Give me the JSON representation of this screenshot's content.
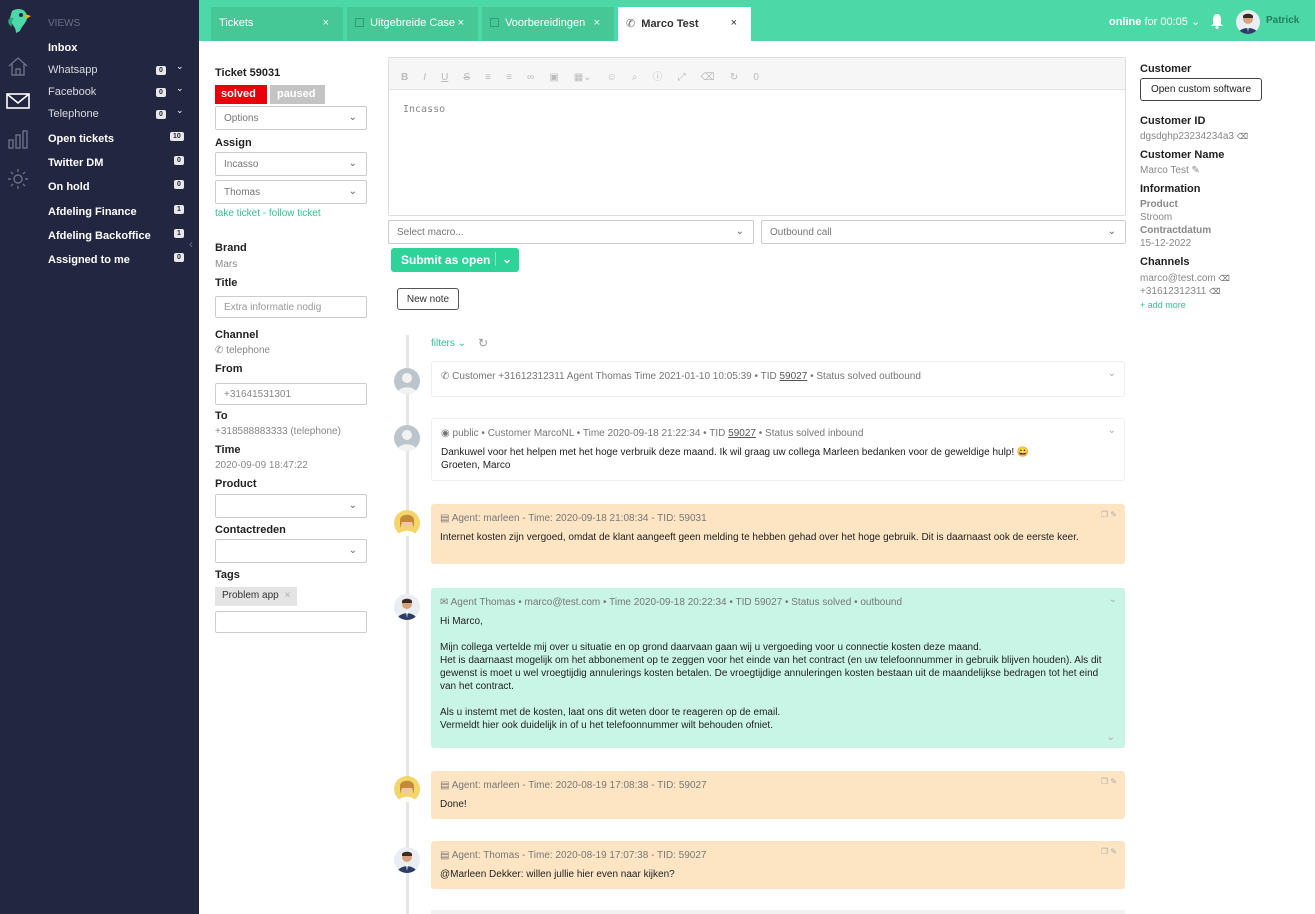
{
  "views": {
    "title": "VIEWS",
    "items": [
      {
        "label": "Inbox",
        "badge": "",
        "bold": true
      },
      {
        "label": "Whatsapp",
        "badge": "0",
        "sub": true
      },
      {
        "label": "Facebook",
        "badge": "0",
        "sub": true
      },
      {
        "label": "Telephone",
        "badge": "0",
        "sub": true
      },
      {
        "label": "Open tickets",
        "badge": "10"
      },
      {
        "label": "Twitter DM",
        "badge": "0"
      },
      {
        "label": "On hold",
        "badge": "0"
      },
      {
        "label": "Afdeling Finance",
        "badge": "1"
      },
      {
        "label": "Afdeling Backoffice",
        "badge": "1"
      },
      {
        "label": "Assigned to me",
        "badge": "0"
      }
    ]
  },
  "tabs": [
    {
      "label": "Tickets"
    },
    {
      "label": "Uitgebreide Case"
    },
    {
      "label": "Voorbereidingen"
    },
    {
      "label": "Marco Test"
    }
  ],
  "topbar": {
    "status": "online",
    "status_suffix": "for 00:05",
    "user": "Patrick"
  },
  "ticket": {
    "title": "Ticket 59031",
    "status_solved": "solved",
    "status_paused": "paused",
    "options": "Options",
    "assign_label": "Assign",
    "assign_group": "Incasso",
    "assign_agent": "Thomas",
    "take_follow": "take ticket - follow ticket",
    "brand_label": "Brand",
    "brand": "Mars",
    "title_label": "Title",
    "title_placeholder": "Extra informatie nodig",
    "channel_label": "Channel",
    "channel": "telephone",
    "from_label": "From",
    "from": "+31641531301",
    "to_label": "To",
    "to": "+318588883333 (telephone)",
    "time_label": "Time",
    "time": "2020-09-09 18:47:22",
    "product_label": "Product",
    "contactreden_label": "Contactreden",
    "tags_label": "Tags",
    "tag": "Problem app"
  },
  "editor": {
    "content": "Incasso",
    "counter": "0",
    "macro_placeholder": "Select macro...",
    "outbound": "Outbound call",
    "submit": "Submit as open",
    "new_note": "New note",
    "filters": "filters"
  },
  "timeline": [
    {
      "type": "call",
      "meta": "Customer +31612312311 Agent Thomas Time 2021-01-10 10:05:39 • TID",
      "tid": "59027",
      "meta_after": "• Status solved outbound",
      "body": []
    },
    {
      "type": "public",
      "meta": "public • Customer MarcoNL • Time 2020-09-18 21:22:34 • TID",
      "tid": "59027",
      "meta_after": "• Status solved inbound",
      "body": [
        "Dankuwel voor het helpen met het hoge verbruik deze maand. Ik wil graag uw collega Marleen bedanken voor de geweldige hulp! 😀",
        "Groeten, Marco"
      ]
    },
    {
      "type": "note",
      "meta": "Agent: marleen - Time: 2020-09-18 21:08:34 - TID: 59031",
      "body": [
        "Internet kosten zijn vergoed, omdat de klant aangeeft geen melding te hebben gehad over het hoge gebruik. Dit is daarnaast ook de eerste keer."
      ]
    },
    {
      "type": "email",
      "meta": "Agent Thomas • marco@test.com • Time 2020-09-18 20:22:34 • TID 59027 • Status solved • outbound",
      "body": [
        "Hi Marco,",
        "",
        "Mijn collega vertelde mij over u situatie en op grond daarvaan gaan wij u vergoeding voor u connectie kosten deze maand.",
        "Het is daarnaast mogelijk om het abbonement op te zeggen voor het einde van het contract (en uw telefoonnummer in gebruik blijven houden). Als dit gewenst is moet u wel vroegtijdig annulerings kosten betalen. De vroegtijdige annuleringen kosten bestaan uit de maandelijkse bedragen tot het eind van het contract.",
        "",
        "Als u instemt met de kosten, laat ons dit weten door te reageren op de email.",
        "Vermeldt hier ook duidelijk in of u het telefoonnummer wilt behouden ofniet."
      ]
    },
    {
      "type": "note",
      "meta": "Agent: marleen - Time: 2020-08-19 17:08:38 - TID: 59027",
      "body": [
        "Done!"
      ]
    },
    {
      "type": "note",
      "meta": "Agent: Thomas - Time: 2020-08-19 17:07:38 - TID: 59027",
      "body": [
        "@Marleen Dekker: willen jullie hier even naar kijken?"
      ]
    }
  ],
  "customer": {
    "label": "Customer",
    "open_btn": "Open custom software",
    "id_label": "Customer ID",
    "id": "dgsdghp23234234a3",
    "name_label": "Customer Name",
    "name": "Marco Test",
    "info_label": "Information",
    "product_key": "Product",
    "product_val": "Stroom",
    "contract_key": "Contractdatum",
    "contract_val": "15-12-2022",
    "channels_label": "Channels",
    "email": "marco@test.com",
    "phone": "+31612312311",
    "add_more": "+ add more"
  },
  "colors": {
    "brand": "#4dd8a7",
    "sidebar": "#232640",
    "note": "#fde5c4",
    "email": "#c9f5e6",
    "solved": "#e8000b",
    "paused": "#c4c4c4"
  }
}
